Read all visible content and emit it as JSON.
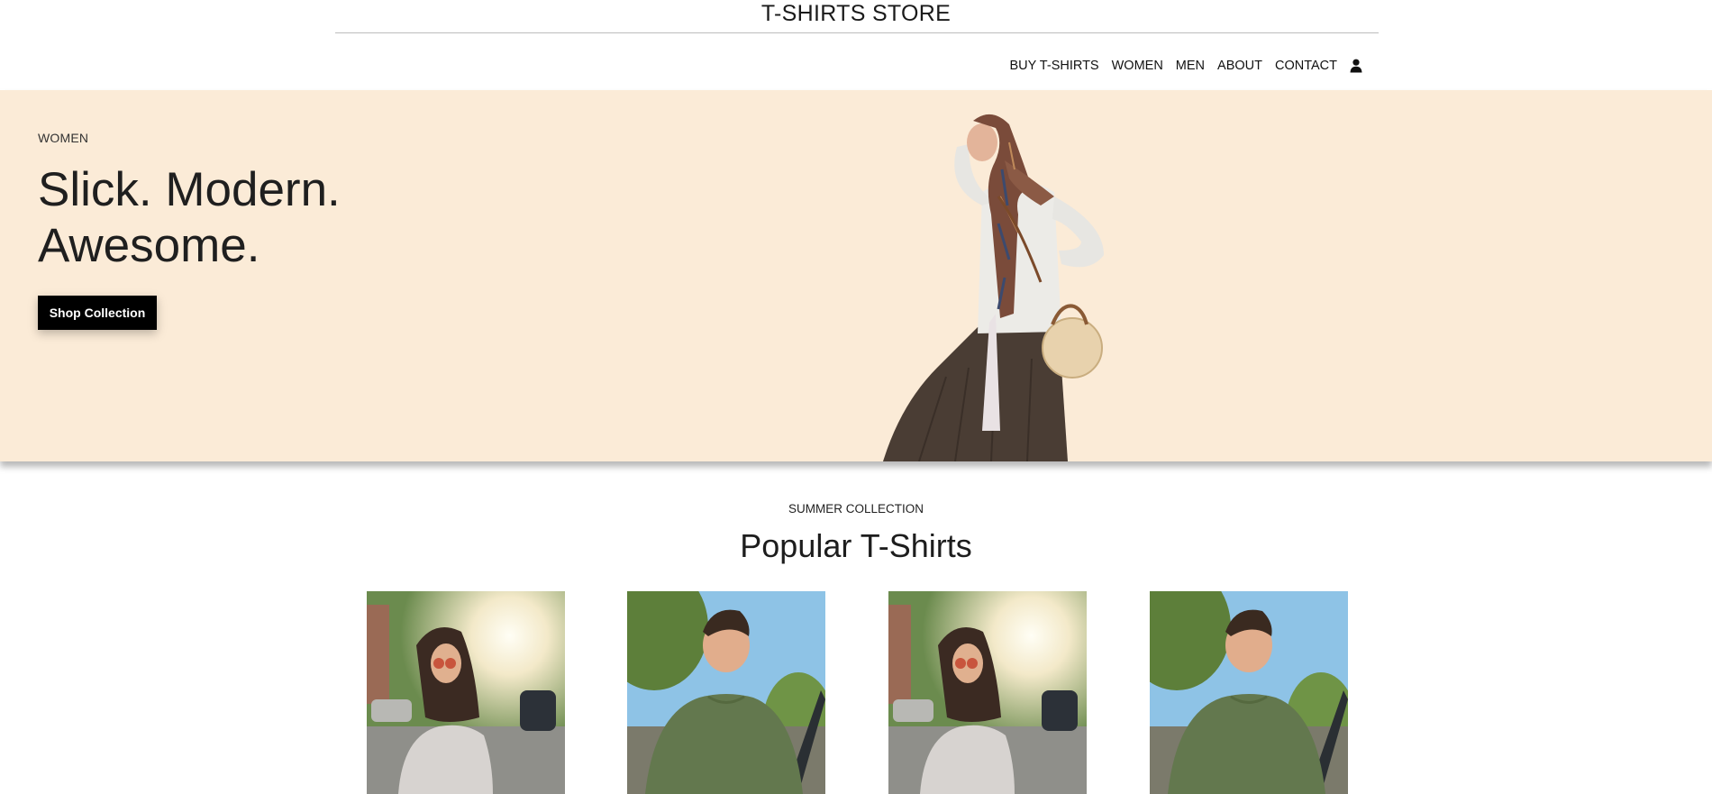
{
  "header": {
    "store_title": "T-SHIRTS STORE"
  },
  "nav": {
    "items": [
      {
        "label": "BUY T-SHIRTS"
      },
      {
        "label": "WOMEN"
      },
      {
        "label": "MEN"
      },
      {
        "label": "ABOUT"
      },
      {
        "label": "CONTACT"
      }
    ],
    "user_icon": "user-icon"
  },
  "hero": {
    "eyebrow": "WOMEN",
    "heading_line1": "Slick. Modern.",
    "heading_line2": "Awesome.",
    "button_label": "Shop Collection",
    "background_color": "#fbebd7",
    "image": "woman-in-headscarf-photo"
  },
  "section": {
    "eyebrow": "SUMMER COLLECTION",
    "heading": "Popular T-Shirts"
  },
  "products": [
    {
      "image": "woman-white-tshirt-photo"
    },
    {
      "image": "man-green-tshirt-photo"
    },
    {
      "image": "woman-white-tshirt-photo"
    },
    {
      "image": "man-green-tshirt-photo"
    }
  ]
}
